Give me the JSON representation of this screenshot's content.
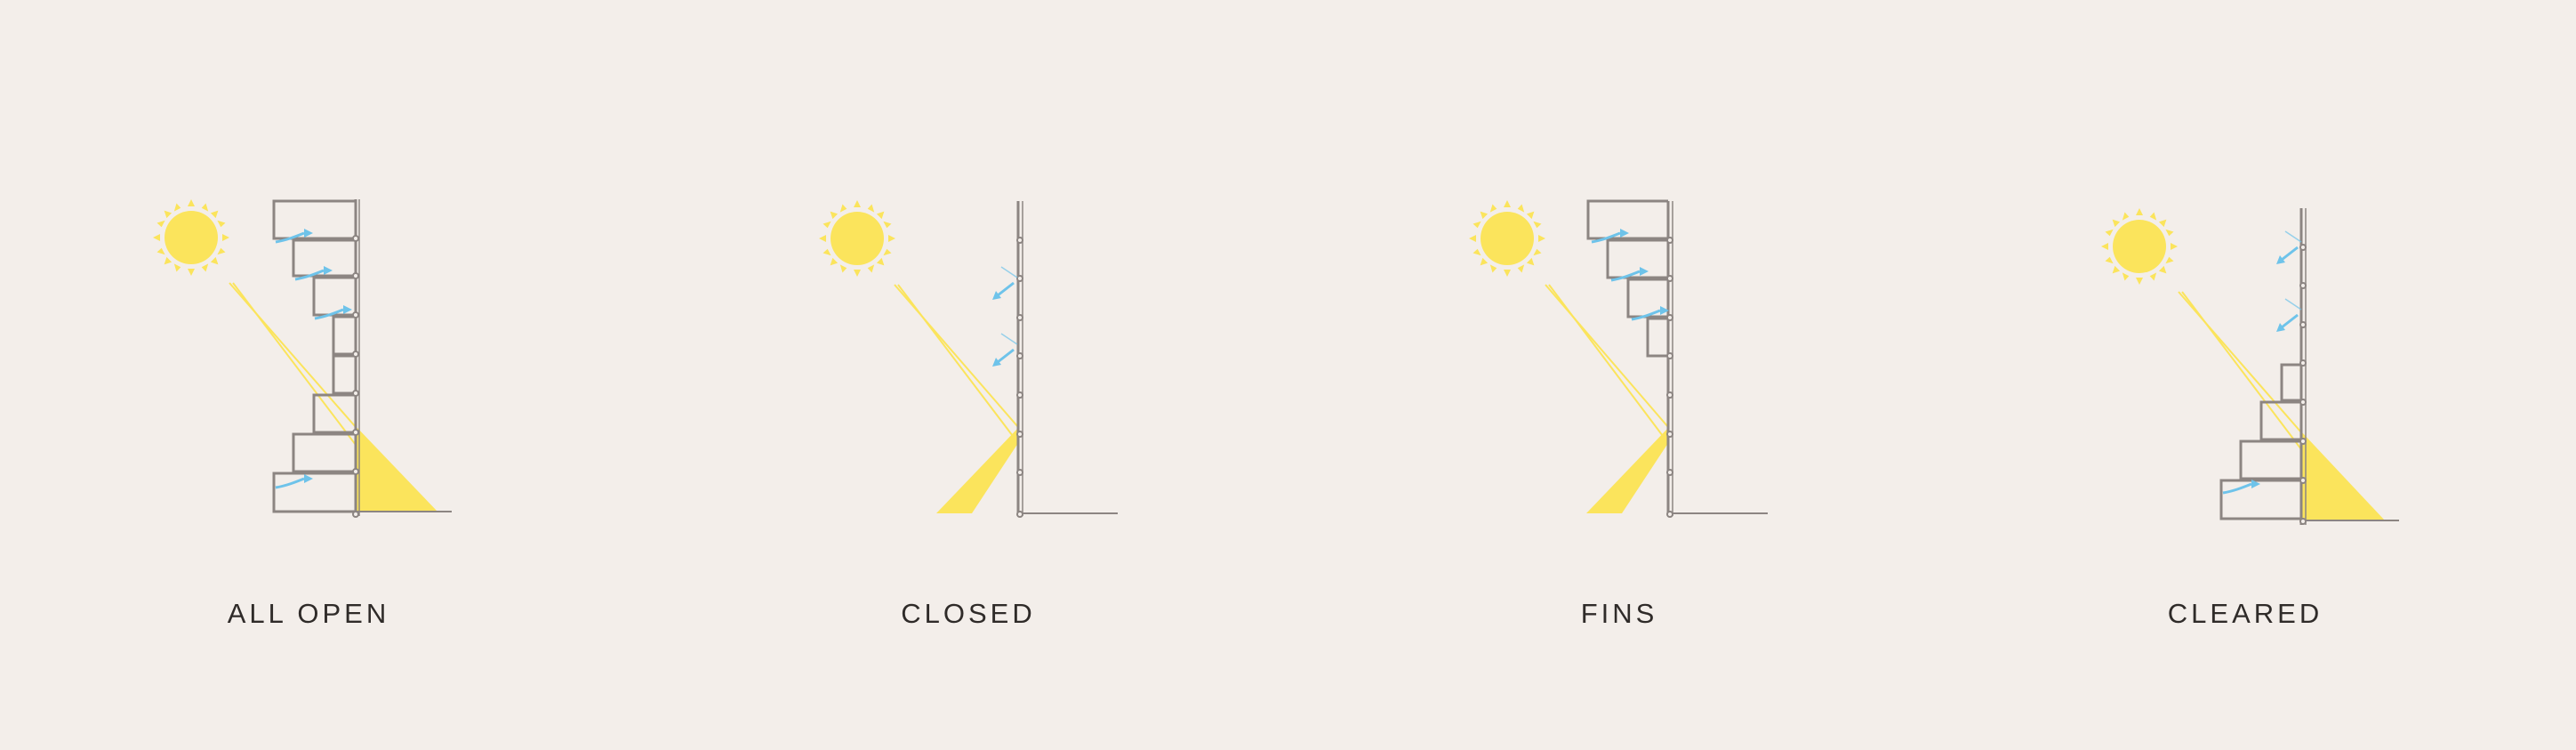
{
  "panels": [
    {
      "id": "all-open",
      "label": "ALL OPEN"
    },
    {
      "id": "closed",
      "label": "CLOSED"
    },
    {
      "id": "fins",
      "label": "FINS"
    },
    {
      "id": "cleared",
      "label": "CLEARED"
    }
  ],
  "colors": {
    "background": "#f3eeea",
    "sun": "#fbe45c",
    "light": "#fbe45c",
    "structure": "#8c8582",
    "airflow": "#6ec3ea",
    "text": "#2f2b29"
  },
  "icons": [
    "sun-icon",
    "airflow-arrow-icon"
  ]
}
